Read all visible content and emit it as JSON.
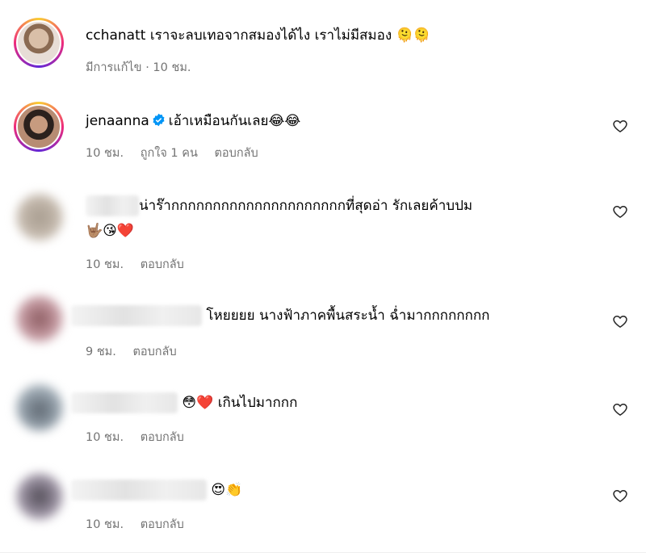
{
  "comments": [
    {
      "username": "cchanatt",
      "text": "เราจะลบเทอจากสมองได้ไง เราไม่มีสมอง 🫠🫠",
      "meta": [
        "มีการแก้ไข · 10 ชม."
      ]
    },
    {
      "username": "jenaanna",
      "verified": true,
      "text": "เอ้าเหมือนกันเลย😂😂",
      "time": "10 ชม.",
      "likes": "ถูกใจ 1 คน",
      "reply": "ตอบกลับ"
    },
    {
      "text": "น่าร๊ากกกกกกกกกกกกกกกกกกกกกที่สุดอ่า รักเลยค้าบปม",
      "text2": "🤟🏽😘❤️",
      "time": "10 ชม.",
      "reply": "ตอบกลับ"
    },
    {
      "text": "โหยยยย นางฟ้าภาคพื้นสระน้ำ ฉ่ำมากกกกกกกก",
      "time": "9 ชม.",
      "reply": "ตอบกลับ"
    },
    {
      "text": "😳❤️ เกินไปมากกก",
      "time": "10 ชม.",
      "reply": "ตอบกลับ"
    },
    {
      "text": "😍👏",
      "time": "10 ชม.",
      "reply": "ตอบกลับ"
    }
  ],
  "icons": {
    "like": "heart-outline-icon",
    "verified": "verified-badge-icon"
  },
  "colors": {
    "meta": "#737373",
    "verified": "#0095f6"
  }
}
